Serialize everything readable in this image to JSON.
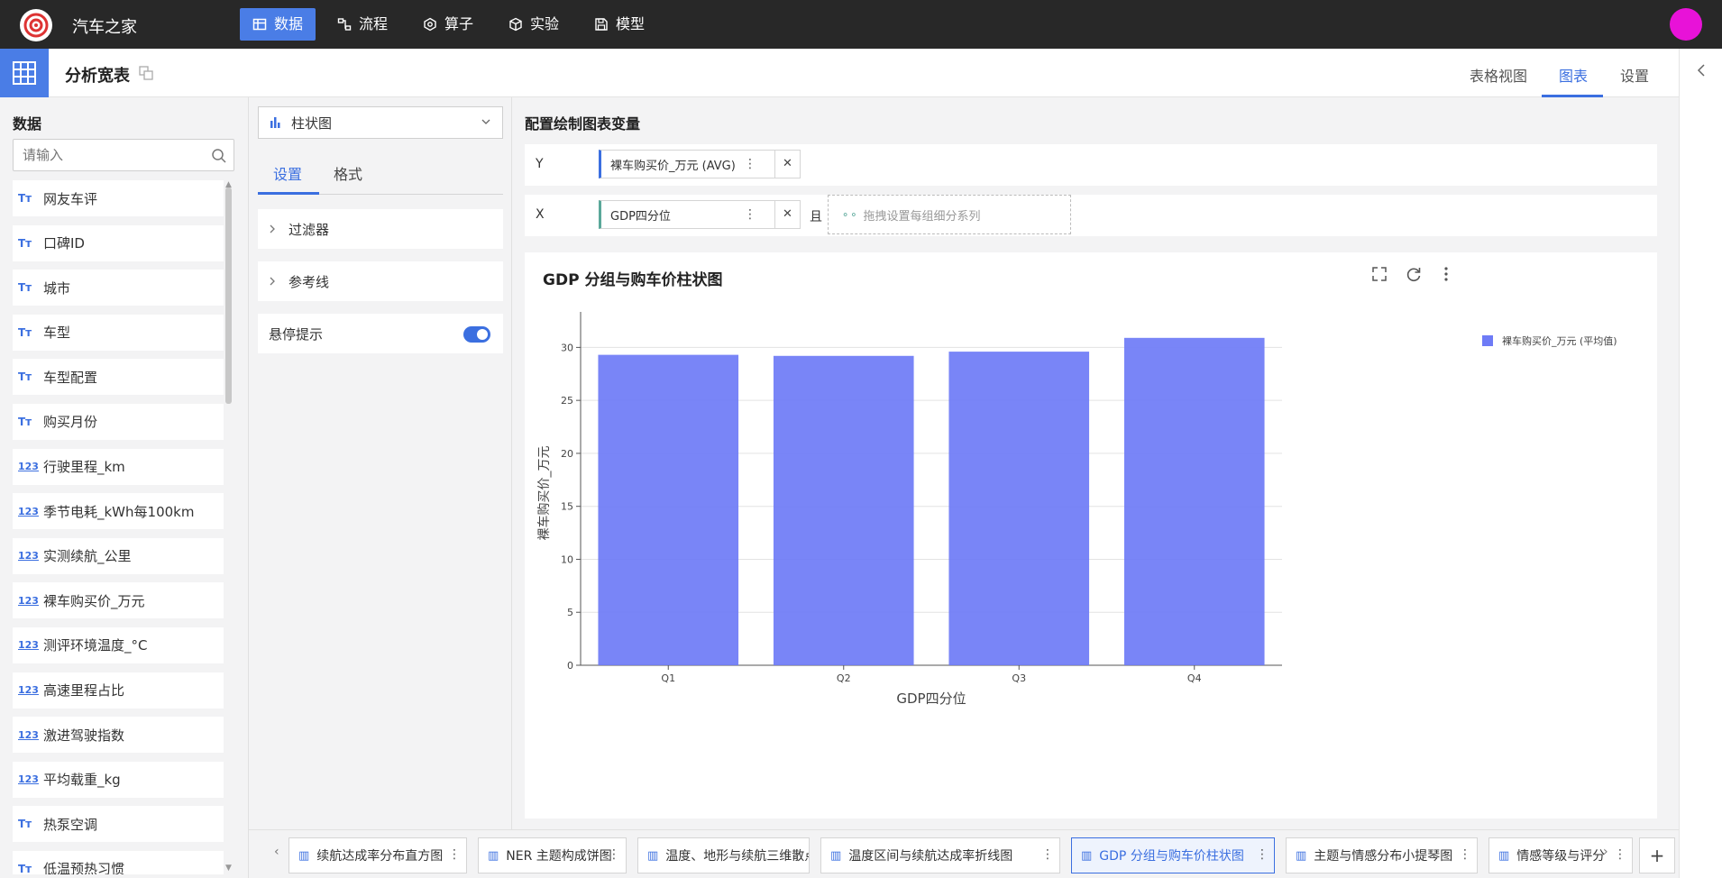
{
  "topbar": {
    "brand": "汽车之家",
    "nav": [
      {
        "label": "数据",
        "icon": "table-icon"
      },
      {
        "label": "流程",
        "icon": "flow-icon"
      },
      {
        "label": "算子",
        "icon": "operator-icon"
      },
      {
        "label": "实验",
        "icon": "experiment-icon"
      },
      {
        "label": "模型",
        "icon": "model-icon"
      }
    ],
    "active_nav": "数据",
    "avatar_color": "#e812d8"
  },
  "subbar": {
    "title": "分析宽表",
    "tabs": [
      "表格视图",
      "图表",
      "设置"
    ],
    "active_tab": "图表"
  },
  "left_panel": {
    "title": "数据",
    "search_placeholder": "请输入",
    "fields": [
      {
        "type": "Tт",
        "name": "网友车评"
      },
      {
        "type": "Tт",
        "name": "口碑ID"
      },
      {
        "type": "Tт",
        "name": "城市"
      },
      {
        "type": "Tт",
        "name": "车型"
      },
      {
        "type": "Tт",
        "name": "车型配置"
      },
      {
        "type": "Tт",
        "name": "购买月份"
      },
      {
        "type": "123",
        "name": "行驶里程_km"
      },
      {
        "type": "123",
        "name": "季节电耗_kWh每100km"
      },
      {
        "type": "123",
        "name": "实测续航_公里"
      },
      {
        "type": "123",
        "name": "裸车购买价_万元"
      },
      {
        "type": "123",
        "name": "测评环境温度_°C"
      },
      {
        "type": "123",
        "name": "高速里程占比"
      },
      {
        "type": "123",
        "name": "激进驾驶指数"
      },
      {
        "type": "123",
        "name": "平均载重_kg"
      },
      {
        "type": "Tт",
        "name": "热泵空调"
      },
      {
        "type": "Tт",
        "name": "低温预热习惯"
      }
    ]
  },
  "mid_panel": {
    "chart_type": "柱状图",
    "tabs": [
      "设置",
      "格式"
    ],
    "active_tab": "设置",
    "sections": [
      "过滤器",
      "参考线"
    ],
    "tooltip_label": "悬停提示",
    "tooltip_on": true
  },
  "config": {
    "title": "配置绘制图表变量",
    "y_label": "Y",
    "y_field": "裸车购买价_万元 (AVG)",
    "x_label": "X",
    "x_field": "GDP四分位",
    "and_label": "且",
    "drop_hint": "拖拽设置每组细分系列"
  },
  "chart_card": {
    "title": "GDP 分组与购车价柱状图"
  },
  "chart_data": {
    "type": "bar",
    "categories": [
      "Q1",
      "Q2",
      "Q3",
      "Q4"
    ],
    "series": [
      {
        "name": "裸车购买价_万元 (平均值)",
        "values": [
          29.3,
          29.2,
          29.6,
          30.9
        ],
        "color": "#6e7bf6"
      }
    ],
    "xlabel": "GDP四分位",
    "ylabel": "裸车购买价_万元",
    "ylim": [
      0,
      32.5
    ],
    "yticks": [
      0,
      5,
      10,
      15,
      20,
      25,
      30
    ],
    "grid": true,
    "legend": "top-right"
  },
  "bottom_tabs": [
    {
      "label": "续航达成率分布直方图",
      "icon": "histogram-icon"
    },
    {
      "label": "NER 主题构成饼图",
      "icon": "pie-icon"
    },
    {
      "label": "温度、地形与续航三维散点图",
      "icon": "scatter-icon"
    },
    {
      "label": "温度区间与续航达成率折线图",
      "icon": "line-icon"
    },
    {
      "label": "GDP 分组与购车价柱状图",
      "icon": "bar-icon"
    },
    {
      "label": "主题与情感分布小提琴图",
      "icon": "violin-icon"
    },
    {
      "label": "情感等级与评分",
      "icon": "box-icon"
    }
  ],
  "active_bottom_tab": "GDP 分组与购车价柱状图"
}
